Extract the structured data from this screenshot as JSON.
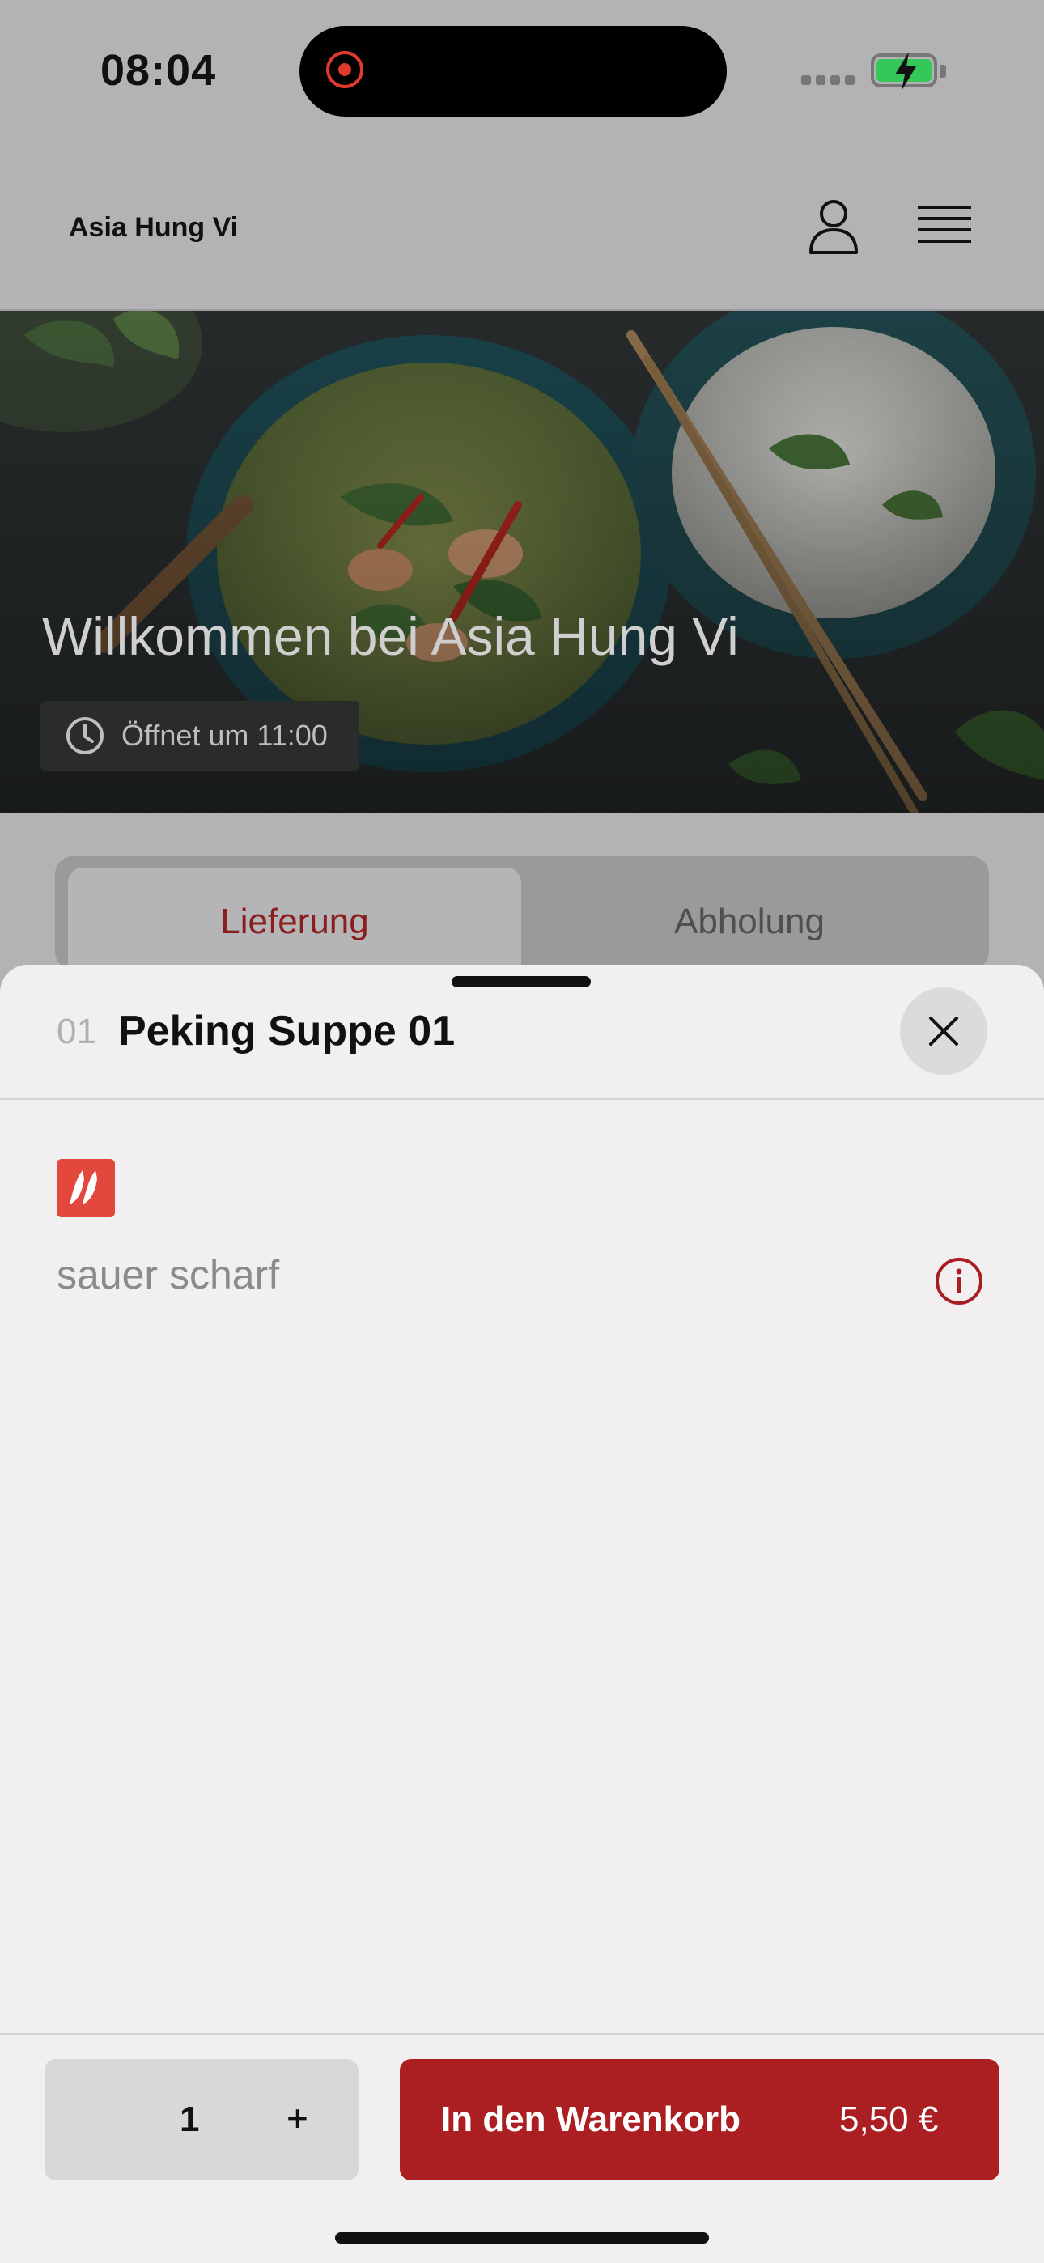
{
  "status_bar": {
    "time": "08:04",
    "battery_charging": true
  },
  "header": {
    "restaurant_name": "Asia Hung Vi",
    "user_icon": "user-icon",
    "menu_icon": "hamburger-menu-icon"
  },
  "hero": {
    "title": "Willkommen bei Asia Hung Vi",
    "hours": "Öffnet um 11:00",
    "clock_icon": "clock-icon"
  },
  "tabs": [
    {
      "label": "Lieferung",
      "active": true
    },
    {
      "label": "Abholung",
      "active": false
    }
  ],
  "item_sheet": {
    "number": "01",
    "title": "Peking Suppe 01",
    "tag_icon": "chili-icon",
    "description": "sauer scharf",
    "info_icon": "info-icon",
    "close_icon": "close-icon"
  },
  "footer": {
    "quantity": "1",
    "plus_label": "+",
    "add_to_cart_label": "In den Warenkorb",
    "price": "5,50 €"
  },
  "colors": {
    "accent": "#ab1f22",
    "active_tab": "#8a1e1e",
    "chili": "#e3483d",
    "battery": "#34c759"
  }
}
